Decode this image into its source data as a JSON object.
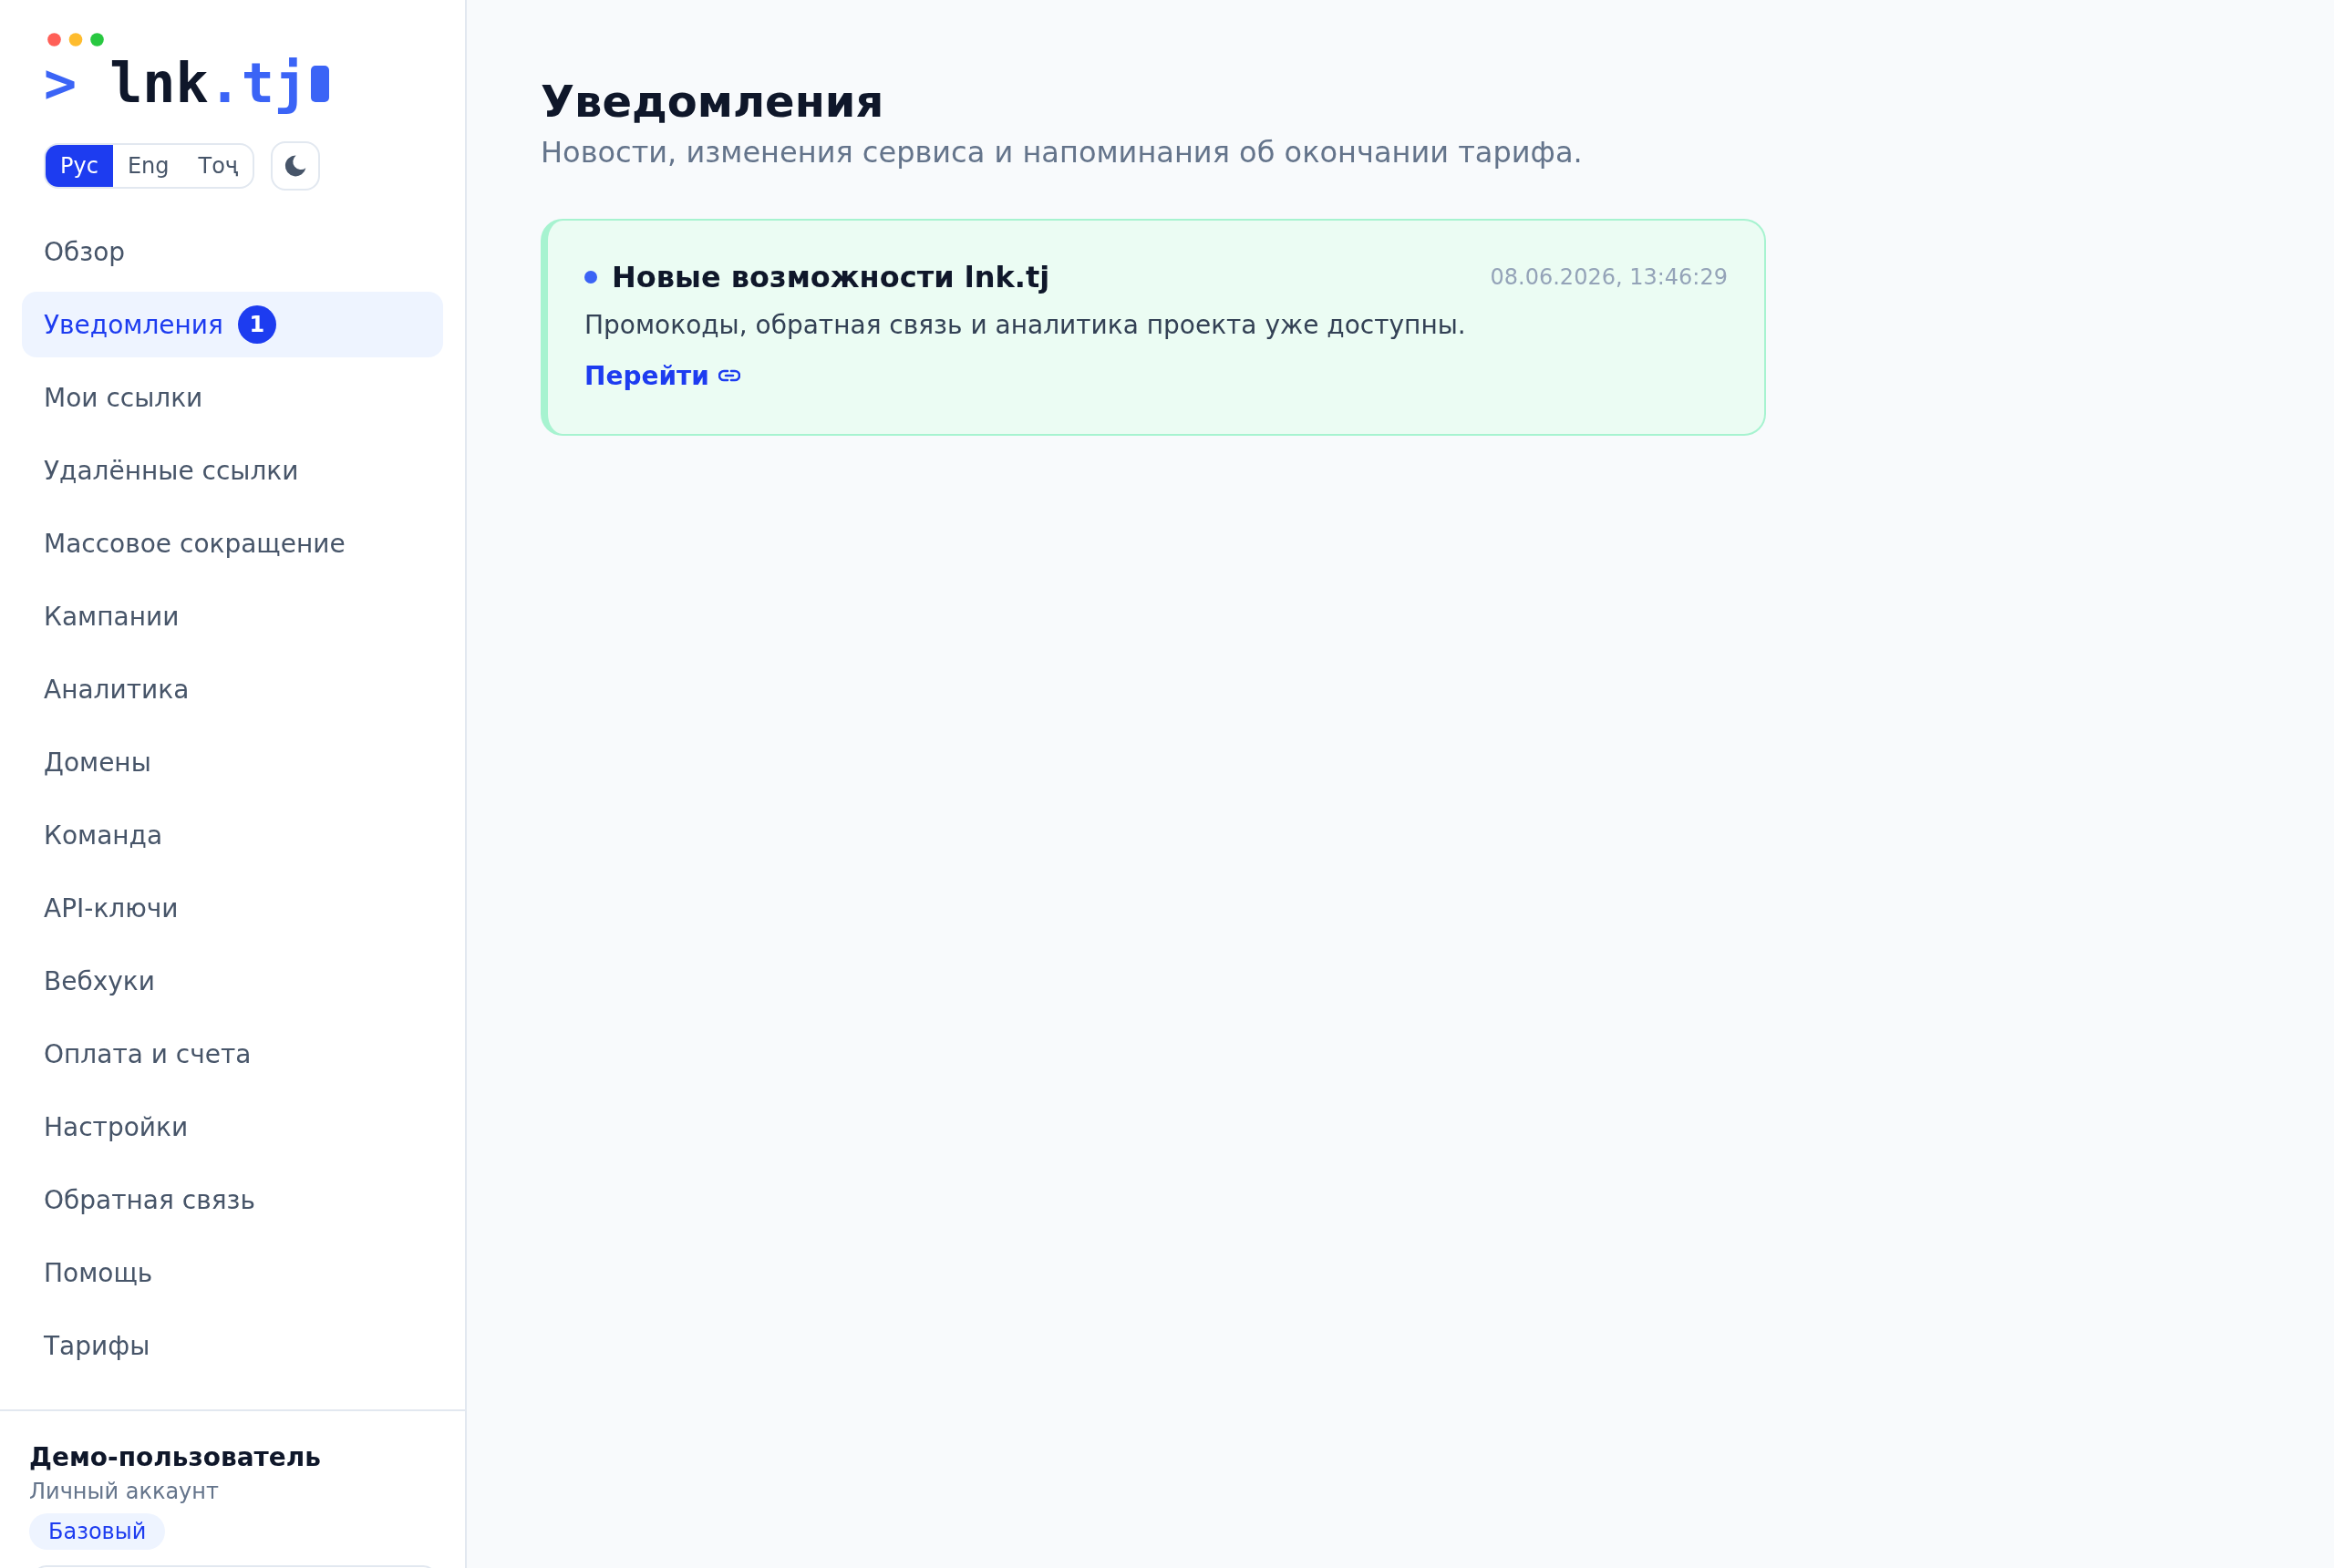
{
  "sidebar": {
    "logo": {
      "prompt": ">",
      "name": "lnk",
      "domain": ".tj"
    },
    "languages": [
      {
        "label": "Рус",
        "selected": true
      },
      {
        "label": "Eng",
        "selected": false
      },
      {
        "label": "Тоҷ",
        "selected": false
      }
    ],
    "nav": [
      {
        "label": "Обзор",
        "selected": false
      },
      {
        "label": "Уведомления",
        "selected": true,
        "badge": "1"
      },
      {
        "label": "Мои ссылки",
        "selected": false
      },
      {
        "label": "Удалённые ссылки",
        "selected": false
      },
      {
        "label": "Массовое сокращение",
        "selected": false
      },
      {
        "label": "Кампании",
        "selected": false
      },
      {
        "label": "Аналитика",
        "selected": false
      },
      {
        "label": "Домены",
        "selected": false
      },
      {
        "label": "Команда",
        "selected": false
      },
      {
        "label": "API-ключи",
        "selected": false
      },
      {
        "label": "Вебхуки",
        "selected": false
      },
      {
        "label": "Оплата и счета",
        "selected": false
      },
      {
        "label": "Настройки",
        "selected": false
      },
      {
        "label": "Обратная связь",
        "selected": false
      },
      {
        "label": "Помощь",
        "selected": false
      },
      {
        "label": "Тарифы",
        "selected": false
      }
    ],
    "account": {
      "name": "Демо-пользователь",
      "type": "Личный аккаунт",
      "plan": "Базовый"
    }
  },
  "page": {
    "title": "Уведомления",
    "subtitle": "Новости, изменения сервиса и напоминания об окончании тарифа."
  },
  "notifications": [
    {
      "title": "Новые возможности lnk.tj",
      "unread": true,
      "time": "08.06.2026, 13:46:29",
      "text": "Промокоды, обратная связь и аналитика проекта уже доступны.",
      "link": "Перейти"
    }
  ]
}
